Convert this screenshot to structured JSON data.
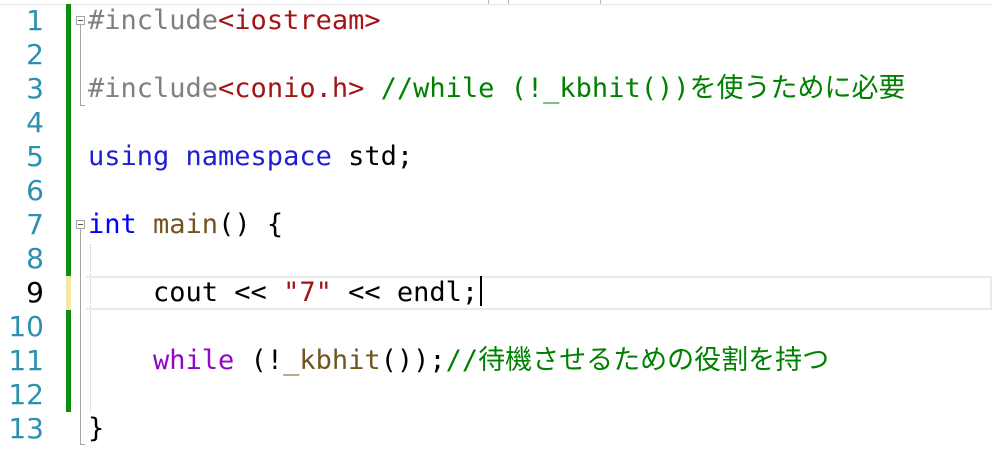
{
  "line_numbers": [
    "1",
    "2",
    "3",
    "4",
    "5",
    "6",
    "7",
    "8",
    "9",
    "10",
    "11",
    "12",
    "13"
  ],
  "current_line": "9",
  "code": {
    "l1": {
      "directive": "#include",
      "header": "<iostream>"
    },
    "l3": {
      "directive": "#include",
      "header": "<conio.h>",
      "comment": " //while (!_kbhit())を使うために必要"
    },
    "l5": {
      "keyword": "using namespace",
      "rest": " std;"
    },
    "l7": {
      "type": "int",
      "func": " main",
      "rest": "() {"
    },
    "l9": {
      "ident": "cout",
      "op1": " << ",
      "str": "\"7\"",
      "op2": " << ",
      "ident2": "endl;"
    },
    "l11": {
      "keyword": "while",
      "punc1": " (!",
      "func": "_kbhit",
      "punc2": "());",
      "comment": "//待機させるための役割を持つ"
    },
    "l13": {
      "brace": "}"
    }
  }
}
